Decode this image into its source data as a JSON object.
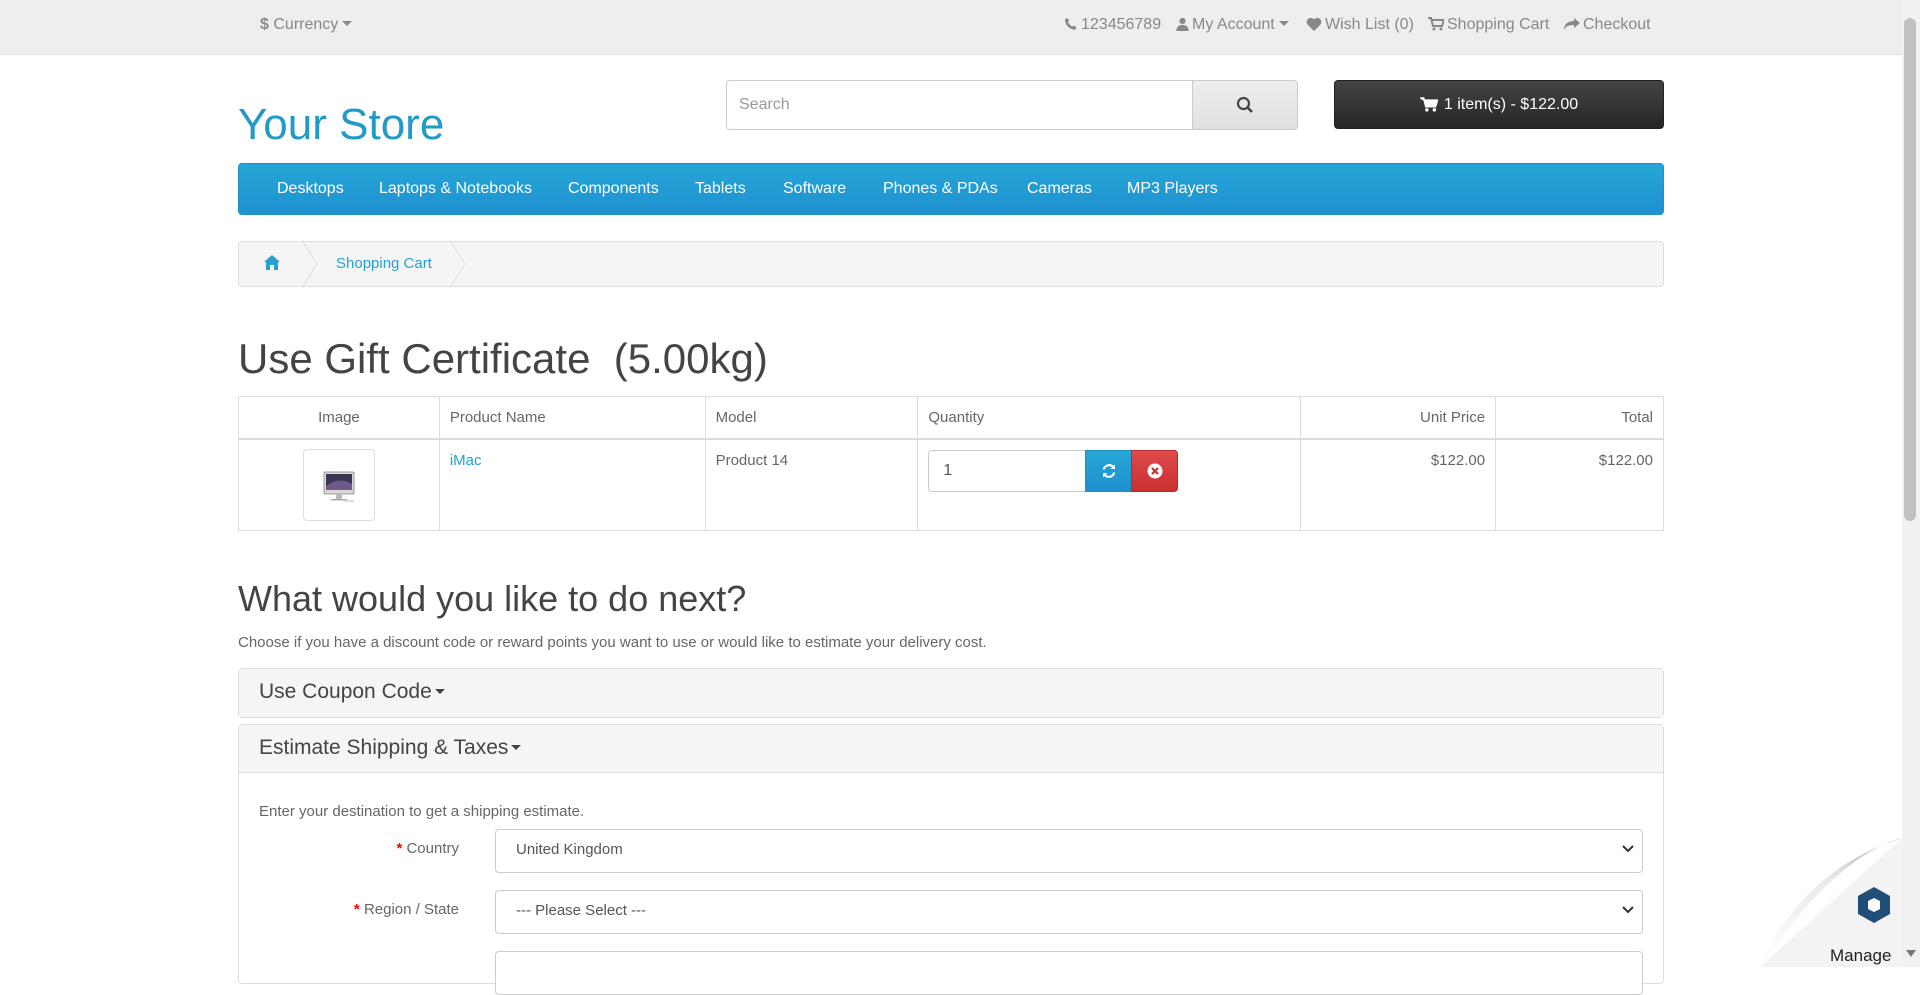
{
  "topbar": {
    "currency": "Currency",
    "phone": "123456789",
    "my_account": "My Account",
    "wish_list": "Wish List (0)",
    "shopping_cart": "Shopping Cart",
    "checkout": "Checkout"
  },
  "header": {
    "logo": "Your Store",
    "search_placeholder": "Search",
    "cart_button": "1 item(s) - $122.00"
  },
  "menu": [
    "Desktops",
    "Laptops & Notebooks",
    "Components",
    "Tablets",
    "Software",
    "Phones & PDAs",
    "Cameras",
    "MP3 Players"
  ],
  "breadcrumb": {
    "current": "Shopping Cart"
  },
  "page_title": "Use Gift Certificate  (5.00kg)",
  "cart_table": {
    "headers": [
      "Image",
      "Product Name",
      "Model",
      "Quantity",
      "Unit Price",
      "Total"
    ],
    "rows": [
      {
        "product": "iMac",
        "model": "Product 14",
        "quantity": "1",
        "unit_price": "$122.00",
        "total": "$122.00"
      }
    ]
  },
  "next": {
    "heading": "What would you like to do next?",
    "intro": "Choose if you have a discount code or reward points you want to use or would like to estimate your delivery cost."
  },
  "coupon_panel": {
    "title": "Use Coupon Code"
  },
  "shipping_panel": {
    "title": "Estimate Shipping & Taxes",
    "text": "Enter your destination to get a shipping estimate.",
    "country_label": "Country",
    "country_value": "United Kingdom",
    "region_label": "Region / State",
    "region_value": "--- Please Select ---"
  },
  "manage_widget": {
    "label": "Manage"
  },
  "colors": {
    "accent": "#229ac8",
    "danger": "#d9534f",
    "dark_button": "#303030"
  }
}
